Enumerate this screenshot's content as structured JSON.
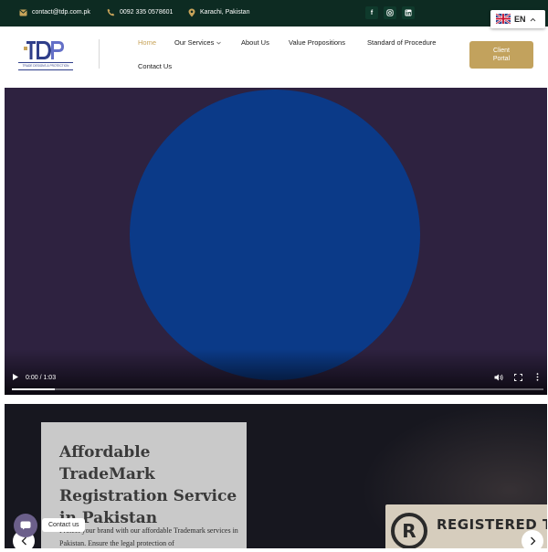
{
  "topbar": {
    "email": "contact@tdp.com.pk",
    "phone": "0092 335 0578601",
    "location": "Karachi, Pakistan",
    "icons": [
      "mail-icon",
      "phone-icon",
      "location-pin-icon",
      "facebook-icon",
      "instagram-icon",
      "linkedin-icon"
    ]
  },
  "language": {
    "code": "EN",
    "flag": "uk-flag-icon"
  },
  "brand": {
    "logo_text": "TDP",
    "tagline": "TRADE DESIGNS & PROTECTION"
  },
  "nav": {
    "items": [
      {
        "label": "Home",
        "active": true
      },
      {
        "label": "Our Services",
        "has_dropdown": true
      },
      {
        "label": "About Us"
      },
      {
        "label": "Value Propositions"
      },
      {
        "label": "Standard of Procedure"
      },
      {
        "label": "Contact Us"
      }
    ],
    "client_portal_line1": "Client",
    "client_portal_line2": "Portal"
  },
  "video": {
    "time": "0:00 / 1:03",
    "progress": 0.08
  },
  "hero": {
    "title": "Affordable TradeMark Registration Service in Pakistan",
    "text": "Protect your brand with our affordable Trademark services in Pakistan. Ensure the legal protection of",
    "sign_mark": "R",
    "sign_text": "REGISTERED TRADEMA"
  },
  "contact": {
    "label": "Contact us"
  },
  "colors": {
    "topbar": "#0d2b22",
    "accent": "#c2a25d",
    "nav_active": "#c8a45a"
  }
}
